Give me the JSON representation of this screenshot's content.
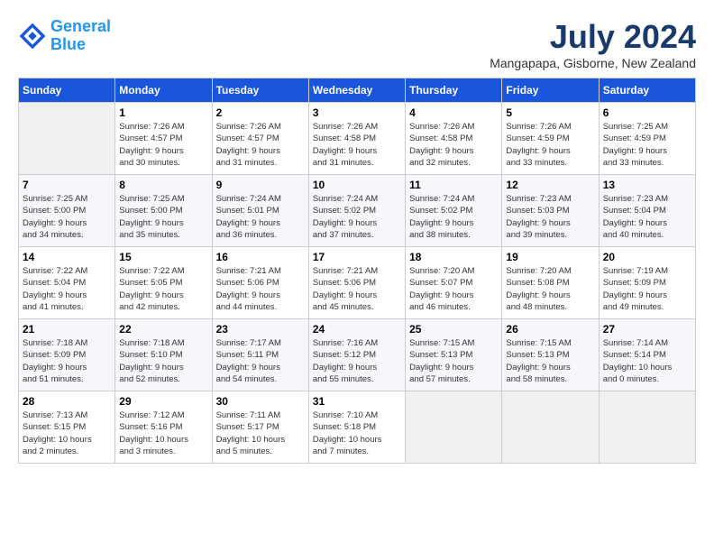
{
  "header": {
    "logo_line1": "General",
    "logo_line2": "Blue",
    "month": "July 2024",
    "location": "Mangapapa, Gisborne, New Zealand"
  },
  "days_of_week": [
    "Sunday",
    "Monday",
    "Tuesday",
    "Wednesday",
    "Thursday",
    "Friday",
    "Saturday"
  ],
  "weeks": [
    [
      {
        "day": "",
        "info": ""
      },
      {
        "day": "1",
        "info": "Sunrise: 7:26 AM\nSunset: 4:57 PM\nDaylight: 9 hours\nand 30 minutes."
      },
      {
        "day": "2",
        "info": "Sunrise: 7:26 AM\nSunset: 4:57 PM\nDaylight: 9 hours\nand 31 minutes."
      },
      {
        "day": "3",
        "info": "Sunrise: 7:26 AM\nSunset: 4:58 PM\nDaylight: 9 hours\nand 31 minutes."
      },
      {
        "day": "4",
        "info": "Sunrise: 7:26 AM\nSunset: 4:58 PM\nDaylight: 9 hours\nand 32 minutes."
      },
      {
        "day": "5",
        "info": "Sunrise: 7:26 AM\nSunset: 4:59 PM\nDaylight: 9 hours\nand 33 minutes."
      },
      {
        "day": "6",
        "info": "Sunrise: 7:25 AM\nSunset: 4:59 PM\nDaylight: 9 hours\nand 33 minutes."
      }
    ],
    [
      {
        "day": "7",
        "info": "Sunrise: 7:25 AM\nSunset: 5:00 PM\nDaylight: 9 hours\nand 34 minutes."
      },
      {
        "day": "8",
        "info": "Sunrise: 7:25 AM\nSunset: 5:00 PM\nDaylight: 9 hours\nand 35 minutes."
      },
      {
        "day": "9",
        "info": "Sunrise: 7:24 AM\nSunset: 5:01 PM\nDaylight: 9 hours\nand 36 minutes."
      },
      {
        "day": "10",
        "info": "Sunrise: 7:24 AM\nSunset: 5:02 PM\nDaylight: 9 hours\nand 37 minutes."
      },
      {
        "day": "11",
        "info": "Sunrise: 7:24 AM\nSunset: 5:02 PM\nDaylight: 9 hours\nand 38 minutes."
      },
      {
        "day": "12",
        "info": "Sunrise: 7:23 AM\nSunset: 5:03 PM\nDaylight: 9 hours\nand 39 minutes."
      },
      {
        "day": "13",
        "info": "Sunrise: 7:23 AM\nSunset: 5:04 PM\nDaylight: 9 hours\nand 40 minutes."
      }
    ],
    [
      {
        "day": "14",
        "info": "Sunrise: 7:22 AM\nSunset: 5:04 PM\nDaylight: 9 hours\nand 41 minutes."
      },
      {
        "day": "15",
        "info": "Sunrise: 7:22 AM\nSunset: 5:05 PM\nDaylight: 9 hours\nand 42 minutes."
      },
      {
        "day": "16",
        "info": "Sunrise: 7:21 AM\nSunset: 5:06 PM\nDaylight: 9 hours\nand 44 minutes."
      },
      {
        "day": "17",
        "info": "Sunrise: 7:21 AM\nSunset: 5:06 PM\nDaylight: 9 hours\nand 45 minutes."
      },
      {
        "day": "18",
        "info": "Sunrise: 7:20 AM\nSunset: 5:07 PM\nDaylight: 9 hours\nand 46 minutes."
      },
      {
        "day": "19",
        "info": "Sunrise: 7:20 AM\nSunset: 5:08 PM\nDaylight: 9 hours\nand 48 minutes."
      },
      {
        "day": "20",
        "info": "Sunrise: 7:19 AM\nSunset: 5:09 PM\nDaylight: 9 hours\nand 49 minutes."
      }
    ],
    [
      {
        "day": "21",
        "info": "Sunrise: 7:18 AM\nSunset: 5:09 PM\nDaylight: 9 hours\nand 51 minutes."
      },
      {
        "day": "22",
        "info": "Sunrise: 7:18 AM\nSunset: 5:10 PM\nDaylight: 9 hours\nand 52 minutes."
      },
      {
        "day": "23",
        "info": "Sunrise: 7:17 AM\nSunset: 5:11 PM\nDaylight: 9 hours\nand 54 minutes."
      },
      {
        "day": "24",
        "info": "Sunrise: 7:16 AM\nSunset: 5:12 PM\nDaylight: 9 hours\nand 55 minutes."
      },
      {
        "day": "25",
        "info": "Sunrise: 7:15 AM\nSunset: 5:13 PM\nDaylight: 9 hours\nand 57 minutes."
      },
      {
        "day": "26",
        "info": "Sunrise: 7:15 AM\nSunset: 5:13 PM\nDaylight: 9 hours\nand 58 minutes."
      },
      {
        "day": "27",
        "info": "Sunrise: 7:14 AM\nSunset: 5:14 PM\nDaylight: 10 hours\nand 0 minutes."
      }
    ],
    [
      {
        "day": "28",
        "info": "Sunrise: 7:13 AM\nSunset: 5:15 PM\nDaylight: 10 hours\nand 2 minutes."
      },
      {
        "day": "29",
        "info": "Sunrise: 7:12 AM\nSunset: 5:16 PM\nDaylight: 10 hours\nand 3 minutes."
      },
      {
        "day": "30",
        "info": "Sunrise: 7:11 AM\nSunset: 5:17 PM\nDaylight: 10 hours\nand 5 minutes."
      },
      {
        "day": "31",
        "info": "Sunrise: 7:10 AM\nSunset: 5:18 PM\nDaylight: 10 hours\nand 7 minutes."
      },
      {
        "day": "",
        "info": ""
      },
      {
        "day": "",
        "info": ""
      },
      {
        "day": "",
        "info": ""
      }
    ]
  ]
}
